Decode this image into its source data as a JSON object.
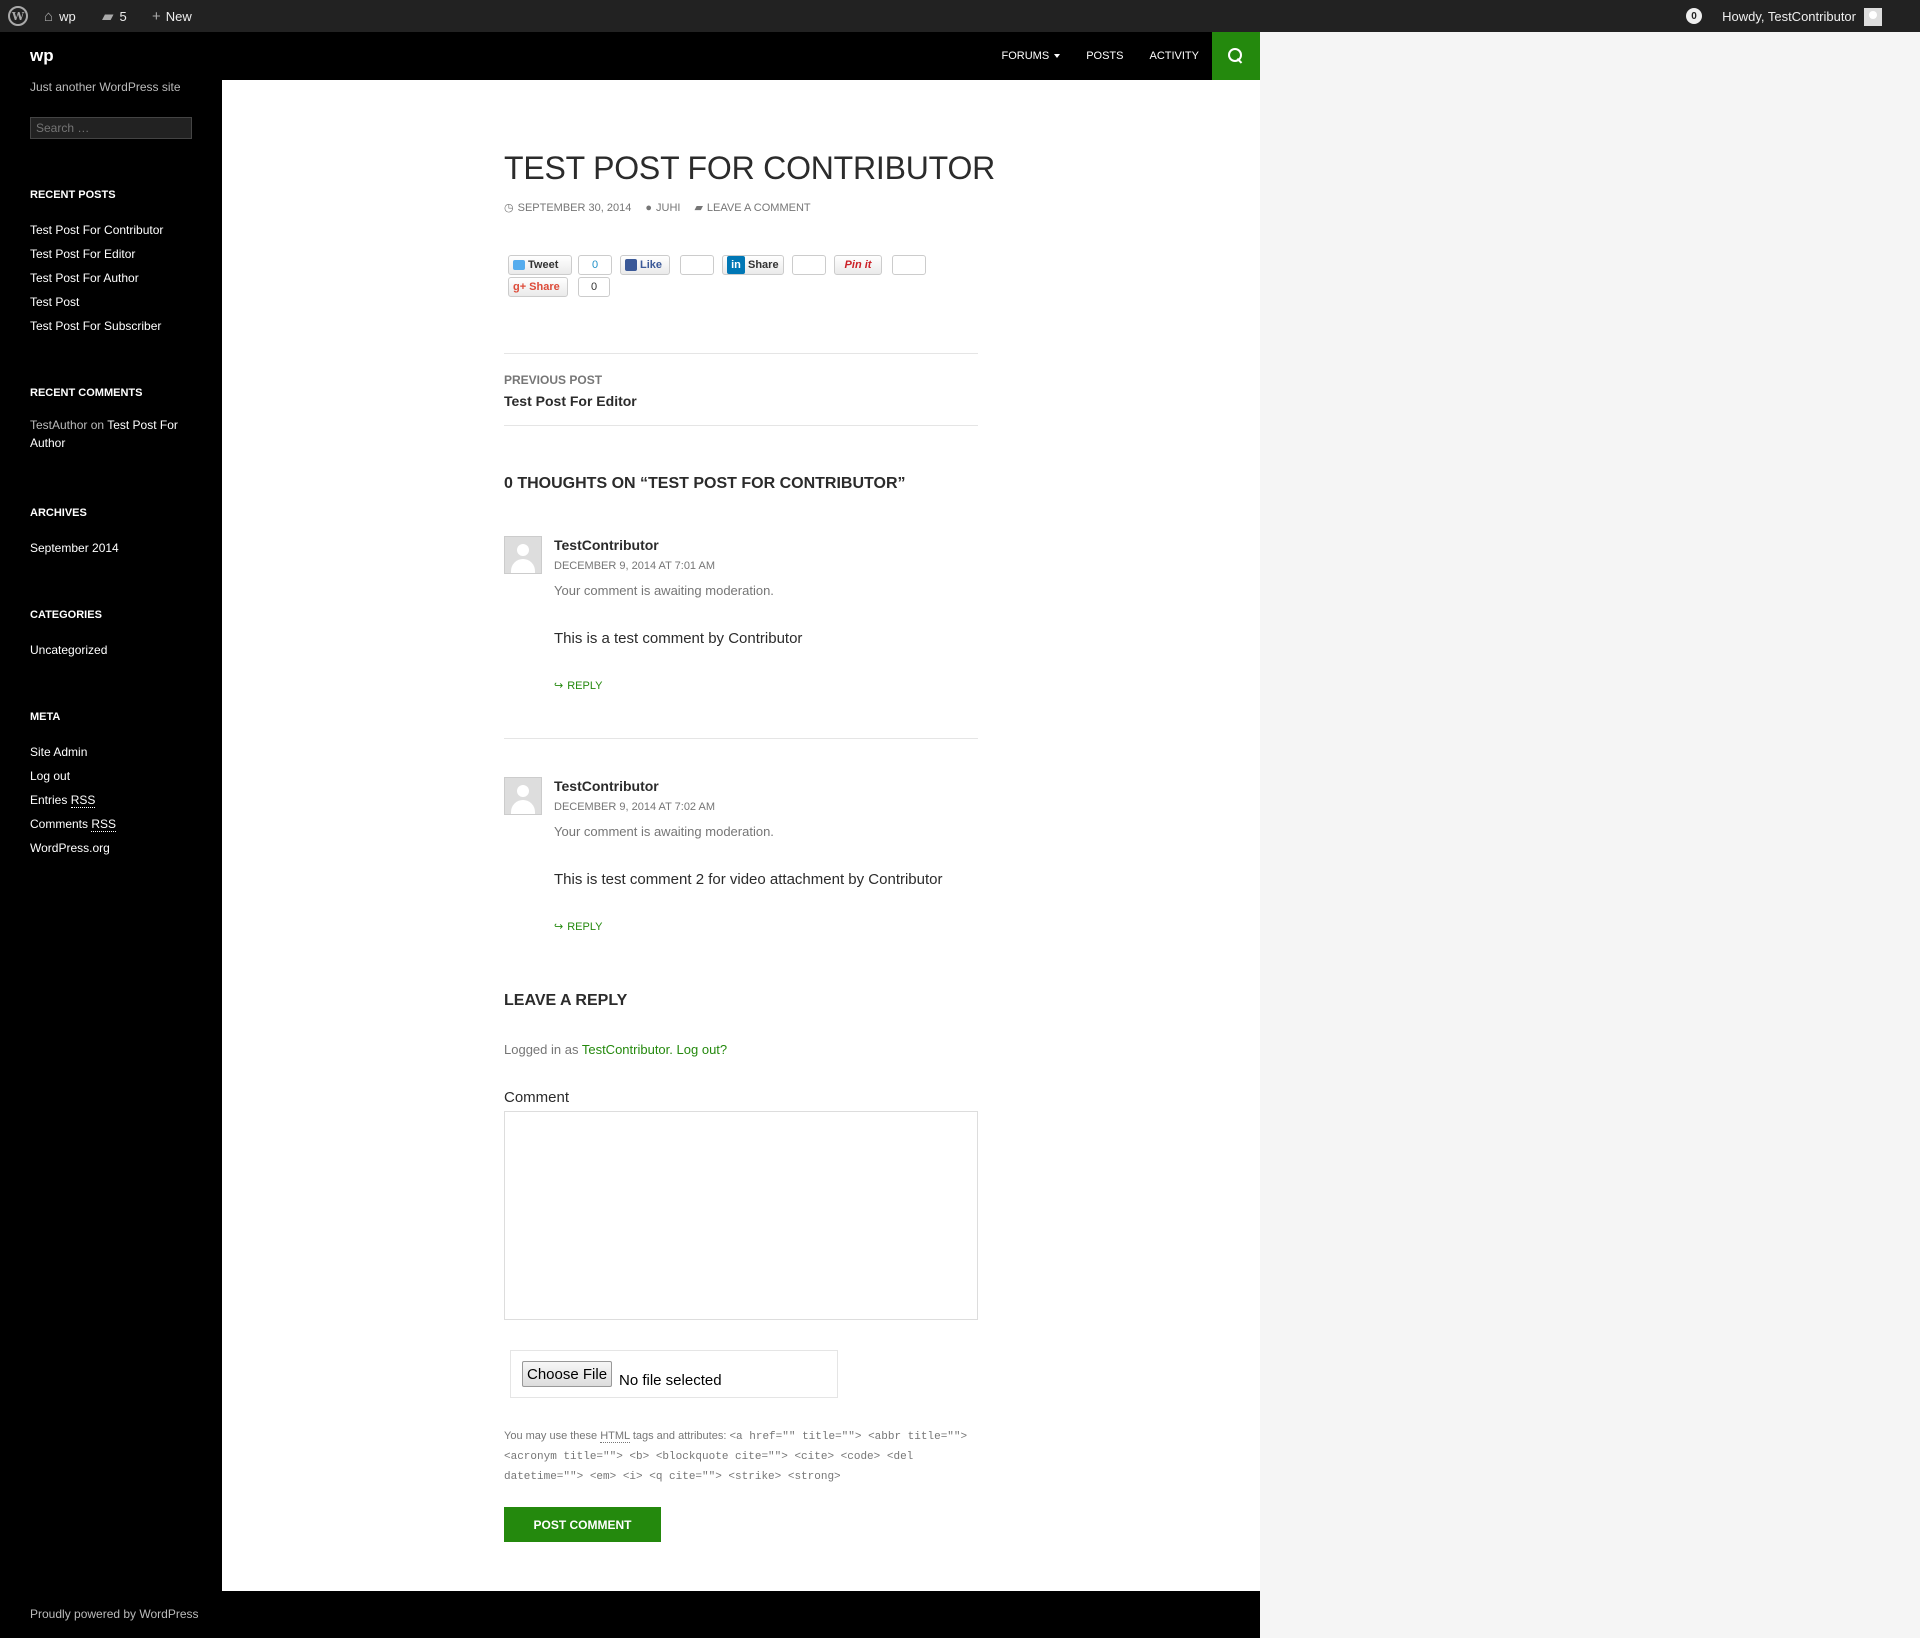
{
  "admin_bar": {
    "site_name": "wp",
    "comments_count": "5",
    "new_label": "New",
    "notification_count": "0",
    "howdy": "Howdy, TestContributor"
  },
  "header": {
    "site_title": "wp",
    "nav": [
      "FORUMS",
      "POSTS",
      "ACTIVITY"
    ],
    "accent_color": "#24890d"
  },
  "sidebar": {
    "tagline": "Just another WordPress site",
    "search_placeholder": "Search …",
    "recent_posts": {
      "title": "RECENT POSTS",
      "items": [
        "Test Post For Contributor",
        "Test Post For Editor",
        "Test Post For Author",
        "Test Post",
        "Test Post For Subscriber"
      ]
    },
    "recent_comments": {
      "title": "RECENT COMMENTS",
      "author": "TestAuthor",
      "on": "on",
      "post": "Test Post For Author"
    },
    "archives": {
      "title": "ARCHIVES",
      "items": [
        "September 2014"
      ]
    },
    "categories": {
      "title": "CATEGORIES",
      "items": [
        "Uncategorized"
      ]
    },
    "meta": {
      "title": "META",
      "site_admin": "Site Admin",
      "log_out": "Log out",
      "entries": "Entries",
      "comments": "Comments",
      "rss": "RSS",
      "wordpress_org": "WordPress.org"
    }
  },
  "post": {
    "title": "TEST POST FOR CONTRIBUTOR",
    "date": "SEPTEMBER 30, 2014",
    "author": "JUHI",
    "leave_comment": "LEAVE A COMMENT"
  },
  "share": {
    "tweet": "Tweet",
    "tweet_count": "0",
    "like": "Like",
    "linkedin": "Share",
    "pinit": "Pin it",
    "gplus": "Share",
    "gplus_count": "0"
  },
  "post_nav": {
    "label": "PREVIOUS POST",
    "link": "Test Post For Editor"
  },
  "comments": {
    "title": "0 THOUGHTS ON “TEST POST FOR CONTRIBUTOR”",
    "items": [
      {
        "author": "TestContributor",
        "date": "DECEMBER 9, 2014 AT 7:01 AM",
        "moderation": "Your comment is awaiting moderation.",
        "text": "This is a test comment by Contributor",
        "reply": "REPLY"
      },
      {
        "author": "TestContributor",
        "date": "DECEMBER 9, 2014 AT 7:02 AM",
        "moderation": "Your comment is awaiting moderation.",
        "text": "This is test comment 2 for video attachment by Contributor",
        "reply": "REPLY"
      }
    ]
  },
  "reply_form": {
    "title": "LEAVE A REPLY",
    "logged_in_prefix": "Logged in as",
    "logged_in_user": "TestContributor",
    "log_out": "Log out?",
    "comment_label": "Comment",
    "file_button": "Choose File",
    "file_status": "No file selected",
    "allowed_prefix": "You may use these",
    "allowed_html": "HTML",
    "allowed_middle": "tags and attributes:",
    "allowed_tags": "<a href=\"\" title=\"\"> <abbr title=\"\"> <acronym title=\"\"> <b> <blockquote cite=\"\"> <cite> <code> <del datetime=\"\"> <em> <i> <q cite=\"\"> <strike> <strong>",
    "submit": "POST COMMENT"
  },
  "footer": {
    "text": "Proudly powered by WordPress"
  }
}
